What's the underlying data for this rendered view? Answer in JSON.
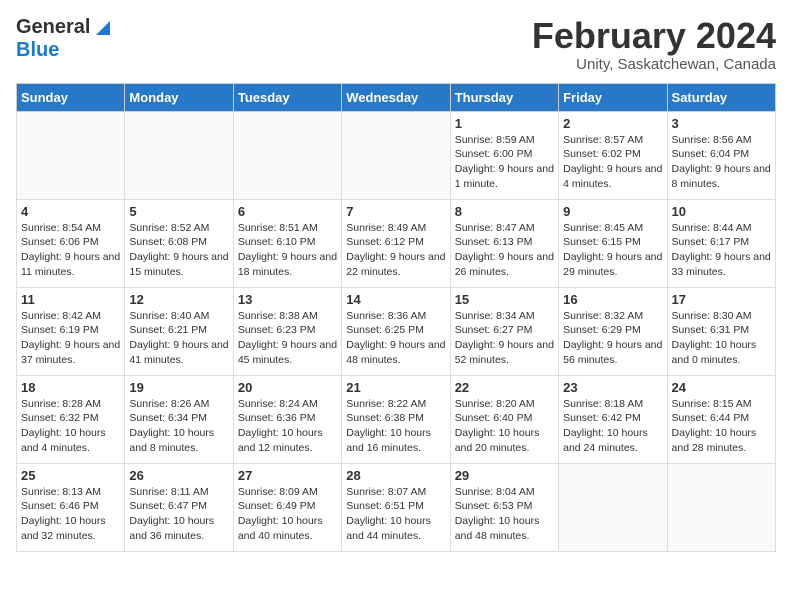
{
  "logo": {
    "general": "General",
    "blue": "Blue"
  },
  "title": {
    "month_year": "February 2024",
    "location": "Unity, Saskatchewan, Canada"
  },
  "headers": [
    "Sunday",
    "Monday",
    "Tuesday",
    "Wednesday",
    "Thursday",
    "Friday",
    "Saturday"
  ],
  "weeks": [
    [
      {
        "day": "",
        "info": ""
      },
      {
        "day": "",
        "info": ""
      },
      {
        "day": "",
        "info": ""
      },
      {
        "day": "",
        "info": ""
      },
      {
        "day": "1",
        "info": "Sunrise: 8:59 AM\nSunset: 6:00 PM\nDaylight: 9 hours\nand 1 minute."
      },
      {
        "day": "2",
        "info": "Sunrise: 8:57 AM\nSunset: 6:02 PM\nDaylight: 9 hours\nand 4 minutes."
      },
      {
        "day": "3",
        "info": "Sunrise: 8:56 AM\nSunset: 6:04 PM\nDaylight: 9 hours\nand 8 minutes."
      }
    ],
    [
      {
        "day": "4",
        "info": "Sunrise: 8:54 AM\nSunset: 6:06 PM\nDaylight: 9 hours\nand 11 minutes."
      },
      {
        "day": "5",
        "info": "Sunrise: 8:52 AM\nSunset: 6:08 PM\nDaylight: 9 hours\nand 15 minutes."
      },
      {
        "day": "6",
        "info": "Sunrise: 8:51 AM\nSunset: 6:10 PM\nDaylight: 9 hours\nand 18 minutes."
      },
      {
        "day": "7",
        "info": "Sunrise: 8:49 AM\nSunset: 6:12 PM\nDaylight: 9 hours\nand 22 minutes."
      },
      {
        "day": "8",
        "info": "Sunrise: 8:47 AM\nSunset: 6:13 PM\nDaylight: 9 hours\nand 26 minutes."
      },
      {
        "day": "9",
        "info": "Sunrise: 8:45 AM\nSunset: 6:15 PM\nDaylight: 9 hours\nand 29 minutes."
      },
      {
        "day": "10",
        "info": "Sunrise: 8:44 AM\nSunset: 6:17 PM\nDaylight: 9 hours\nand 33 minutes."
      }
    ],
    [
      {
        "day": "11",
        "info": "Sunrise: 8:42 AM\nSunset: 6:19 PM\nDaylight: 9 hours\nand 37 minutes."
      },
      {
        "day": "12",
        "info": "Sunrise: 8:40 AM\nSunset: 6:21 PM\nDaylight: 9 hours\nand 41 minutes."
      },
      {
        "day": "13",
        "info": "Sunrise: 8:38 AM\nSunset: 6:23 PM\nDaylight: 9 hours\nand 45 minutes."
      },
      {
        "day": "14",
        "info": "Sunrise: 8:36 AM\nSunset: 6:25 PM\nDaylight: 9 hours\nand 48 minutes."
      },
      {
        "day": "15",
        "info": "Sunrise: 8:34 AM\nSunset: 6:27 PM\nDaylight: 9 hours\nand 52 minutes."
      },
      {
        "day": "16",
        "info": "Sunrise: 8:32 AM\nSunset: 6:29 PM\nDaylight: 9 hours\nand 56 minutes."
      },
      {
        "day": "17",
        "info": "Sunrise: 8:30 AM\nSunset: 6:31 PM\nDaylight: 10 hours\nand 0 minutes."
      }
    ],
    [
      {
        "day": "18",
        "info": "Sunrise: 8:28 AM\nSunset: 6:32 PM\nDaylight: 10 hours\nand 4 minutes."
      },
      {
        "day": "19",
        "info": "Sunrise: 8:26 AM\nSunset: 6:34 PM\nDaylight: 10 hours\nand 8 minutes."
      },
      {
        "day": "20",
        "info": "Sunrise: 8:24 AM\nSunset: 6:36 PM\nDaylight: 10 hours\nand 12 minutes."
      },
      {
        "day": "21",
        "info": "Sunrise: 8:22 AM\nSunset: 6:38 PM\nDaylight: 10 hours\nand 16 minutes."
      },
      {
        "day": "22",
        "info": "Sunrise: 8:20 AM\nSunset: 6:40 PM\nDaylight: 10 hours\nand 20 minutes."
      },
      {
        "day": "23",
        "info": "Sunrise: 8:18 AM\nSunset: 6:42 PM\nDaylight: 10 hours\nand 24 minutes."
      },
      {
        "day": "24",
        "info": "Sunrise: 8:15 AM\nSunset: 6:44 PM\nDaylight: 10 hours\nand 28 minutes."
      }
    ],
    [
      {
        "day": "25",
        "info": "Sunrise: 8:13 AM\nSunset: 6:46 PM\nDaylight: 10 hours\nand 32 minutes."
      },
      {
        "day": "26",
        "info": "Sunrise: 8:11 AM\nSunset: 6:47 PM\nDaylight: 10 hours\nand 36 minutes."
      },
      {
        "day": "27",
        "info": "Sunrise: 8:09 AM\nSunset: 6:49 PM\nDaylight: 10 hours\nand 40 minutes."
      },
      {
        "day": "28",
        "info": "Sunrise: 8:07 AM\nSunset: 6:51 PM\nDaylight: 10 hours\nand 44 minutes."
      },
      {
        "day": "29",
        "info": "Sunrise: 8:04 AM\nSunset: 6:53 PM\nDaylight: 10 hours\nand 48 minutes."
      },
      {
        "day": "",
        "info": ""
      },
      {
        "day": "",
        "info": ""
      }
    ]
  ]
}
